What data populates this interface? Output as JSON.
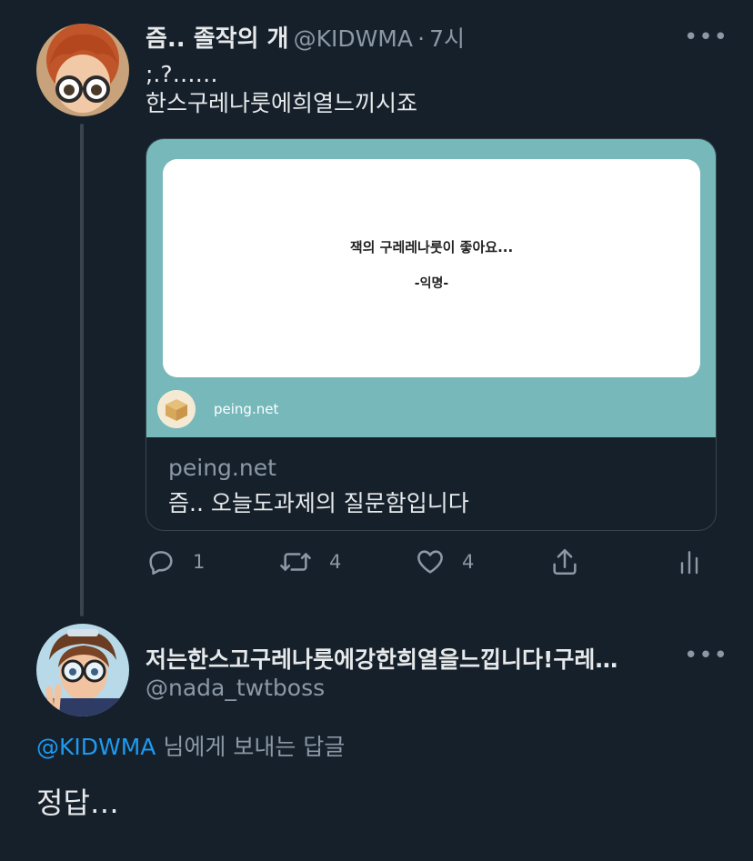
{
  "tweet1": {
    "display_name": "즘.. 졸작의 개",
    "handle": "@KIDWMA",
    "time_sep": "·",
    "time": "7시",
    "more_label": "•••",
    "text_line1": ";.?……",
    "text_line2": "한스구레나룻에희열느끼시죠",
    "card": {
      "question": "잭의 구레레나룻이 좋아요...",
      "signature": "-익명-",
      "site_label": "peing.net",
      "domain": "peing.net",
      "title": "즘.. 오늘도과제의 질문함입니다"
    },
    "actions": {
      "reply_count": "1",
      "retweet_count": "4",
      "like_count": "4"
    },
    "icons": [
      "reply-icon",
      "retweet-icon",
      "like-icon",
      "share-icon",
      "analytics-icon"
    ]
  },
  "tweet2": {
    "display_name": "저는한스고구레나룻에강한희열을느낍니다!구레…",
    "handle": "@nada_twtboss",
    "more_label": "•••",
    "reply_mention": "@KIDWMA",
    "reply_suffix": " 님에게 보내는 답글",
    "text": "정답…"
  },
  "colors": {
    "background": "#15202b",
    "border": "#38444d",
    "muted": "#8b98a5",
    "accent": "#1d9bf0",
    "card_teal": "#77b8ba"
  }
}
